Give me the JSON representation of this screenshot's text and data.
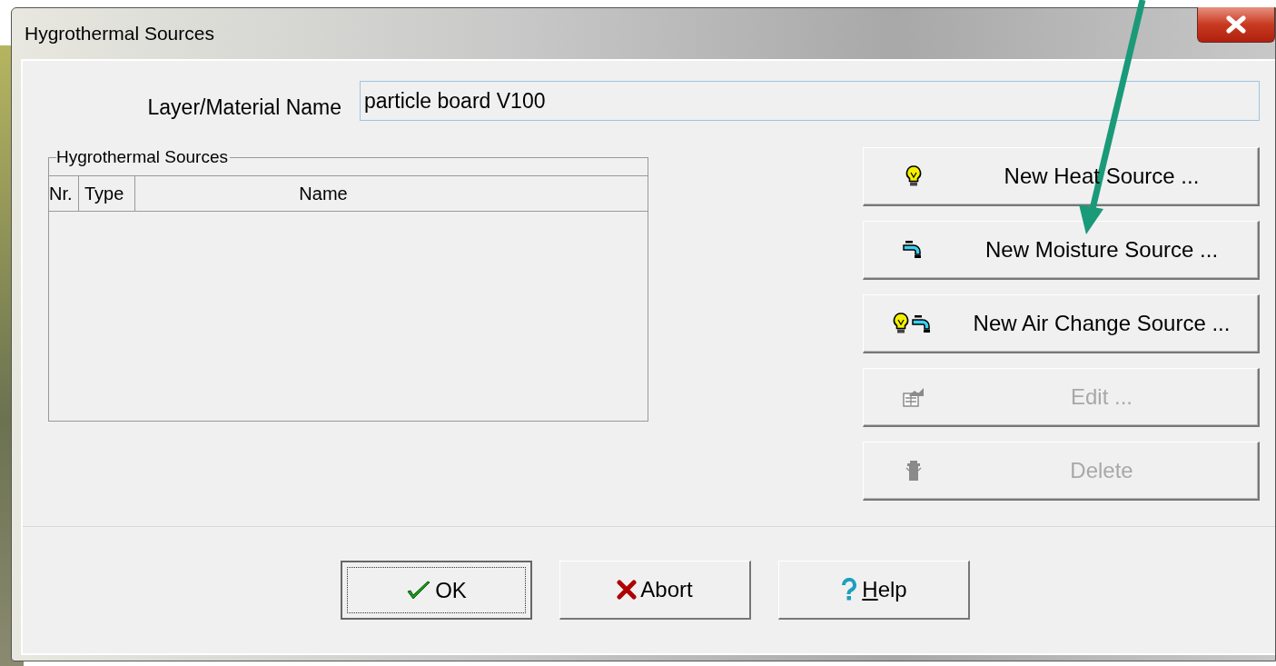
{
  "window": {
    "title": "Hygrothermal Sources"
  },
  "material": {
    "label": "Layer/Material Name",
    "value": "particle board V100"
  },
  "sources_group": {
    "title": "Hygrothermal Sources",
    "columns": [
      "Nr.",
      "Type",
      "Name"
    ]
  },
  "actions": [
    {
      "kind": "heat",
      "label": "New Heat Source ...",
      "disabled": false
    },
    {
      "kind": "moisture",
      "label": "New Moisture Source ...",
      "disabled": false
    },
    {
      "kind": "airchange",
      "label": "New Air Change Source ...",
      "disabled": false
    },
    {
      "kind": "edit",
      "label": "Edit ...",
      "disabled": true
    },
    {
      "kind": "delete",
      "label": "Delete",
      "disabled": true
    }
  ],
  "buttons": [
    {
      "kind": "ok",
      "label": "OK",
      "default": true
    },
    {
      "kind": "abort",
      "label": "Abort",
      "default": false
    },
    {
      "kind": "help",
      "label": "Help",
      "default": false
    }
  ]
}
